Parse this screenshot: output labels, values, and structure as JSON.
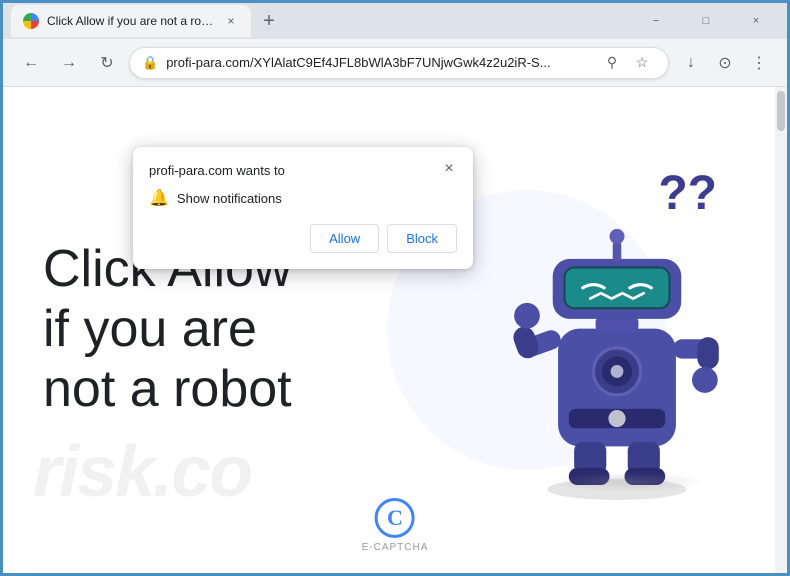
{
  "browser": {
    "tab": {
      "title": "Click Allow if you are not a robot",
      "favicon": "globe",
      "close_label": "×"
    },
    "new_tab_label": "+",
    "window_controls": {
      "minimize": "−",
      "maximize": "□",
      "close": "×"
    },
    "nav": {
      "back": "←",
      "forward": "→",
      "reload": "↻",
      "address": "profi-para.com/XYlAlatC9Ef4JFL8bWlA3bF7UNjwGwk4z2u2iR-S...",
      "lock_icon": "🔒",
      "search_icon": "⚲",
      "bookmark_icon": "☆",
      "account_icon": "⊙",
      "menu_icon": "⋮",
      "download_icon": "↓"
    }
  },
  "notification_popup": {
    "title": "profi-para.com wants to",
    "notification_text": "Show notifications",
    "close_label": "×",
    "bell_icon": "🔔",
    "allow_label": "Allow",
    "block_label": "Block"
  },
  "page": {
    "main_text": "Click Allow if you are not a robot",
    "watermark_text": "risk.co",
    "question_marks": "??",
    "ecaptcha_label": "E-CAPTCHA",
    "ecaptcha_icon": "C"
  }
}
